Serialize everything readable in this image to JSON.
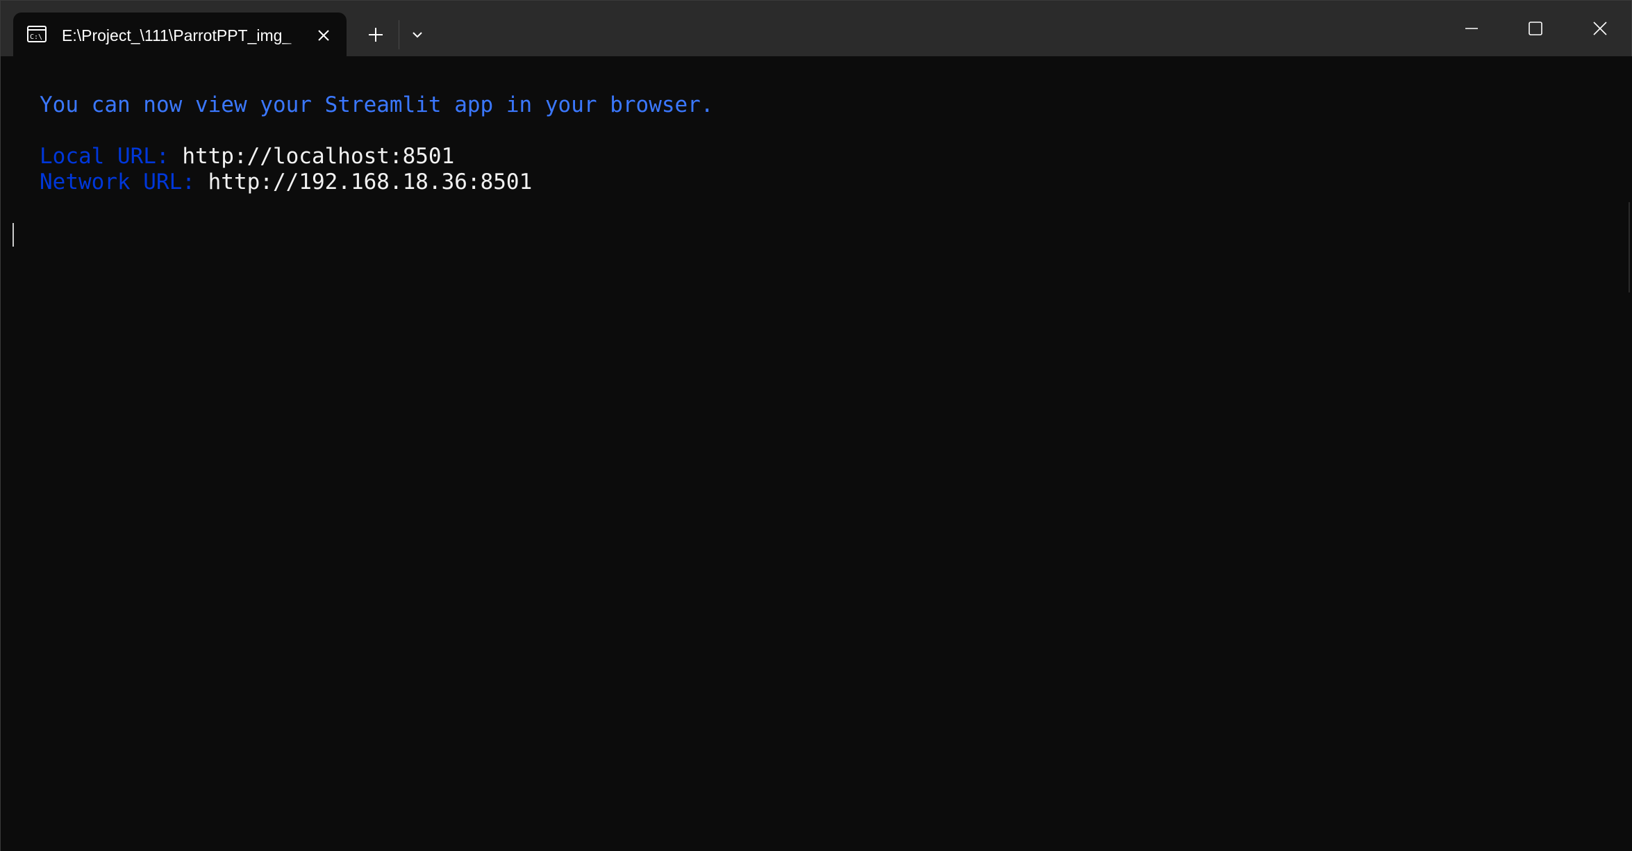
{
  "tab": {
    "title": "E:\\Project_\\111\\ParrotPPT_img_",
    "icon": "command-prompt-icon"
  },
  "titlebar_buttons": {
    "new_tab": "plus-icon",
    "dropdown": "chevron-down-icon",
    "minimize": "minimize-icon",
    "maximize": "maximize-icon",
    "close": "close-icon"
  },
  "terminal": {
    "message": "You can now view your Streamlit app in your browser.",
    "local_label": "Local URL: ",
    "local_url": "http://localhost:8501",
    "network_label": "Network URL: ",
    "network_url": "http://192.168.18.36:8501"
  },
  "colors": {
    "background": "#0c0c0c",
    "titlebar": "#2b2b2b",
    "message_blue": "#3b78ff",
    "label_blue": "#0037da",
    "text": "#f2f2f2"
  }
}
